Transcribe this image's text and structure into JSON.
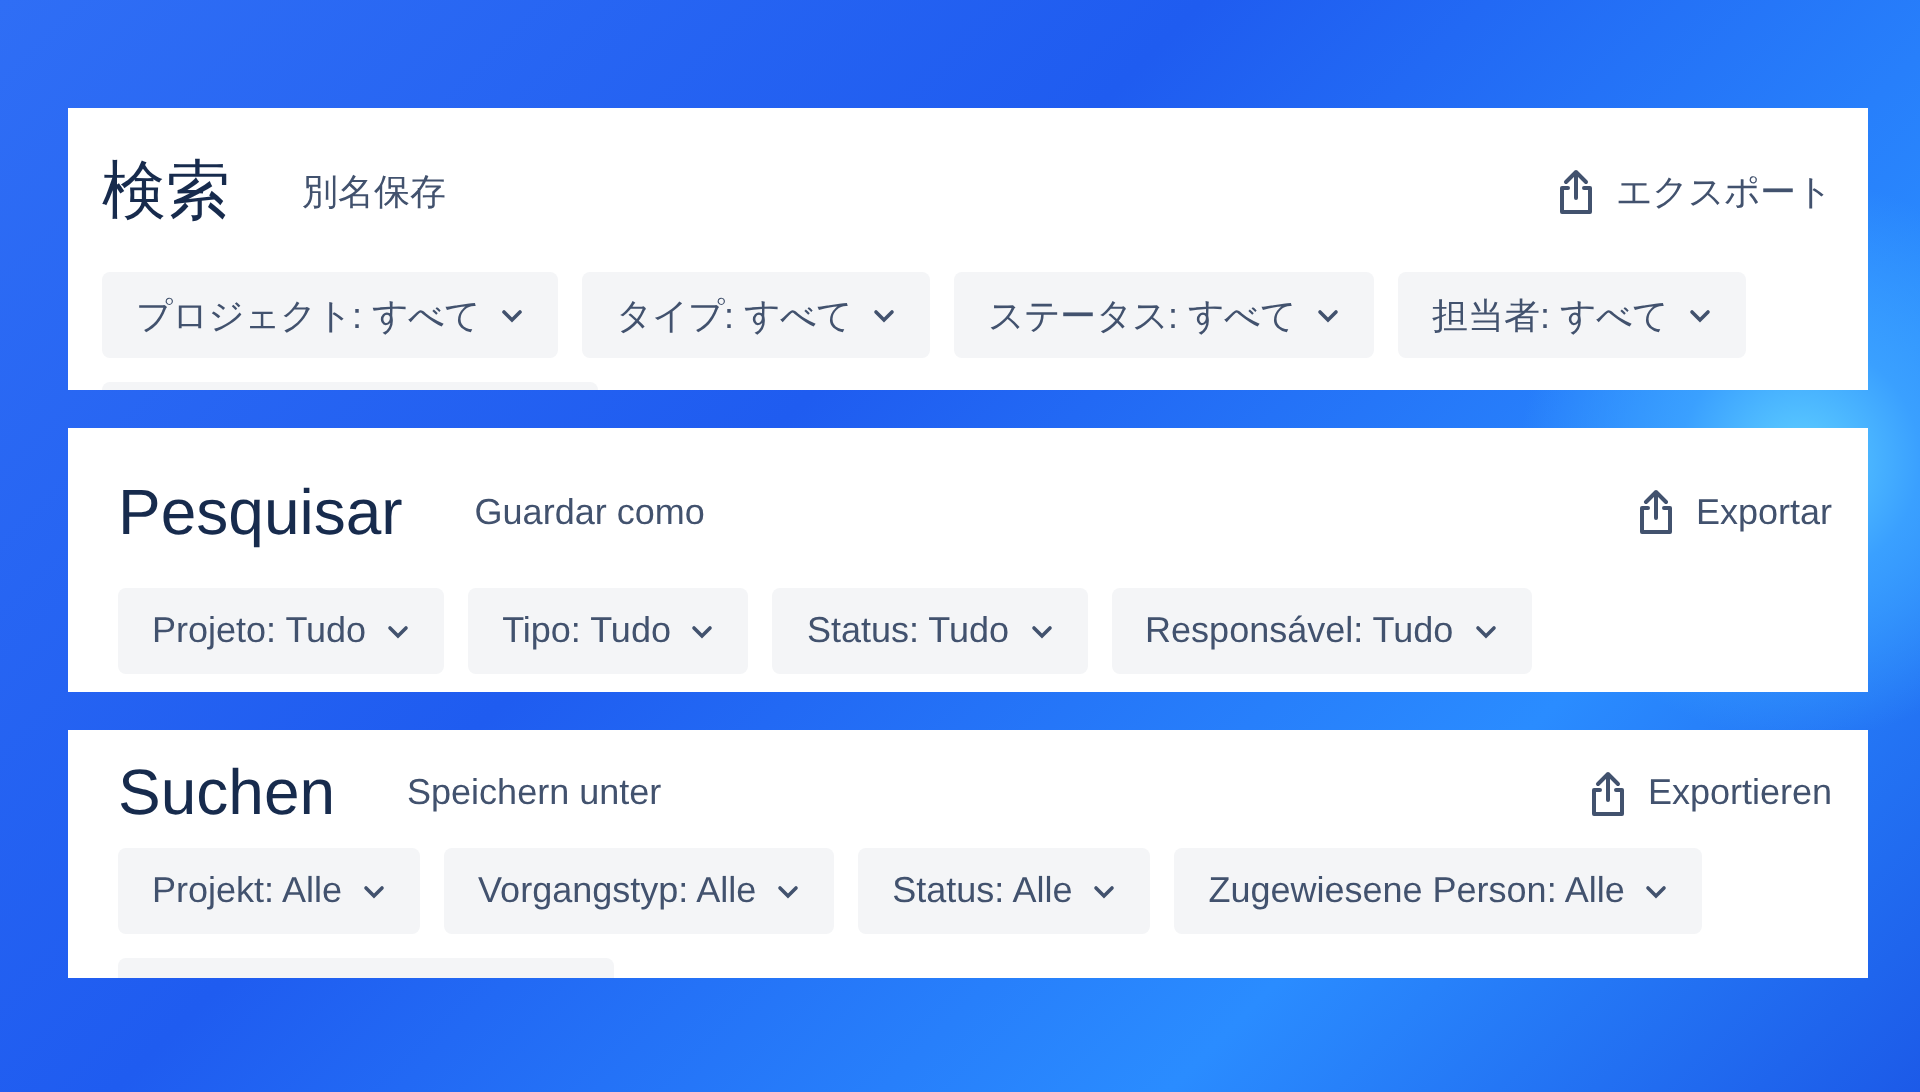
{
  "panels": [
    {
      "title": "検索",
      "save_label": "別名保存",
      "export_label": "エクスポート",
      "filters": [
        "プロジェクト: すべて",
        "タイプ: すべて",
        "ステータス: すべて",
        "担当者: すべて"
      ],
      "cut_row": true
    },
    {
      "title": "Pesquisar",
      "save_label": "Guardar como",
      "export_label": "Exportar",
      "filters": [
        "Projeto: Tudo",
        "Tipo: Tudo",
        "Status: Tudo",
        "Responsável: Tudo"
      ],
      "cut_row": false
    },
    {
      "title": "Suchen",
      "save_label": "Speichern unter",
      "export_label": "Exportieren",
      "filters": [
        "Projekt: Alle",
        "Vorgangstyp: Alle",
        "Status: Alle",
        "Zugewiesene Person: Alle"
      ],
      "cut_row": true
    }
  ]
}
